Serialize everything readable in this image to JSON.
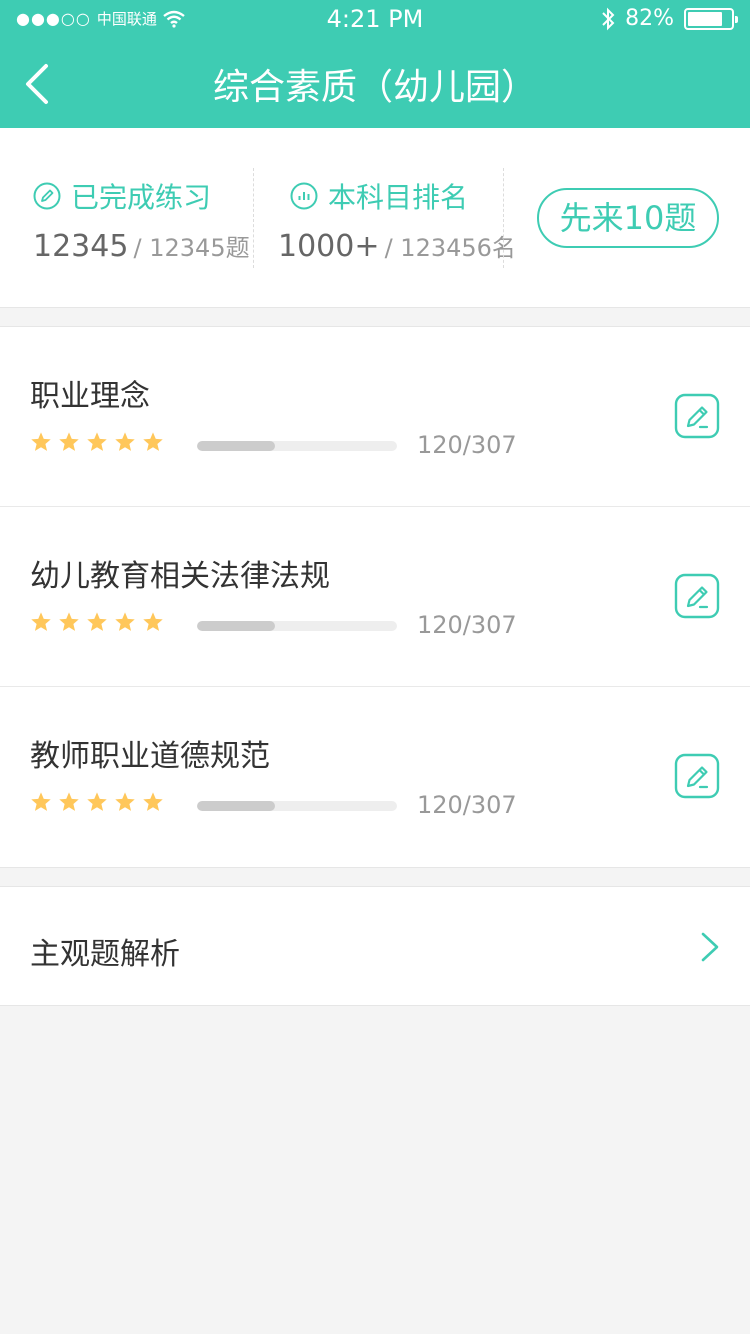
{
  "status": {
    "signal_dots": "●●●○○",
    "carrier": "中国联通",
    "time": "4:21 PM",
    "battery_text": "82%",
    "battery_level": 0.82
  },
  "nav": {
    "title": "综合素质（幼儿园）"
  },
  "summary": {
    "completed": {
      "label": "已完成练习",
      "value": "12345",
      "total": "/ 12345题"
    },
    "ranking": {
      "label": "本科目排名",
      "value": "1000+",
      "total": "/ 123456名"
    },
    "start_button": "先来10题"
  },
  "modules": [
    {
      "title": "职业理念",
      "stars": 5,
      "progress": 0.39,
      "count": "120/307"
    },
    {
      "title": "幼儿教育相关法律法规",
      "stars": 5,
      "progress": 0.39,
      "count": "120/307"
    },
    {
      "title": "教师职业道德规范",
      "stars": 5,
      "progress": 0.39,
      "count": "120/307"
    }
  ],
  "analysis": {
    "label": "主观题解析"
  },
  "colors": {
    "accent": "#3ECCB3",
    "title_text": "#333333",
    "number_text": "#666666",
    "muted_text": "#999999",
    "bar_track": "#EEEEEE",
    "bar_fill": "#CCCCCC",
    "star": "#FFC75A"
  },
  "icons": {
    "back": "chevron-left-icon",
    "completed": "pencil-circle-icon",
    "ranking": "bar-chart-circle-icon",
    "edit": "edit-pencil-icon",
    "star": "star-icon",
    "analysis_arrow": "chevron-right-icon"
  }
}
